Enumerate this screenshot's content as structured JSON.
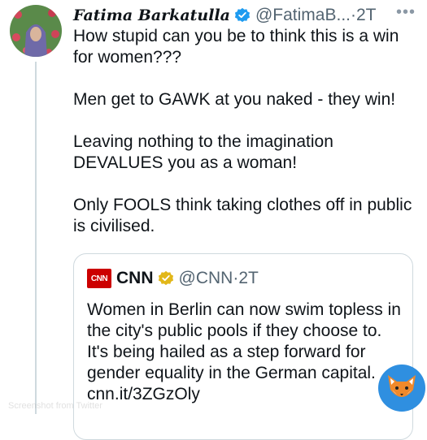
{
  "tweet": {
    "author_name": "Fatima Barkatulla",
    "handle": "@FatimaB...",
    "separator": "·",
    "time": "2T",
    "more_icon": "more-dots-icon",
    "paragraphs": [
      "How stupid can you be to think this is a win for women???",
      "Men get to GAWK at you naked - they win!",
      "Leaving nothing to the imagination DEVALUES you as a woman!",
      "Only FOOLS think taking clothes off in public is civilised."
    ]
  },
  "quote": {
    "logo_text": "CNN",
    "name": "CNN",
    "handle": "@CNN",
    "separator": "·",
    "time": "2T",
    "text": "Women in Berlin can now swim topless in the city's public pools if they choose to. It's being hailed as a step forward for gender equality in the German capital. cnn.it/3ZGzOly"
  },
  "colors": {
    "verified_blue": "#1d9bf0",
    "verified_gold": "#e2b719",
    "cnn_red": "#cc0000",
    "muted_text": "#536471",
    "border": "#cfd9de"
  },
  "watermark": "Screenshot from Twitter"
}
